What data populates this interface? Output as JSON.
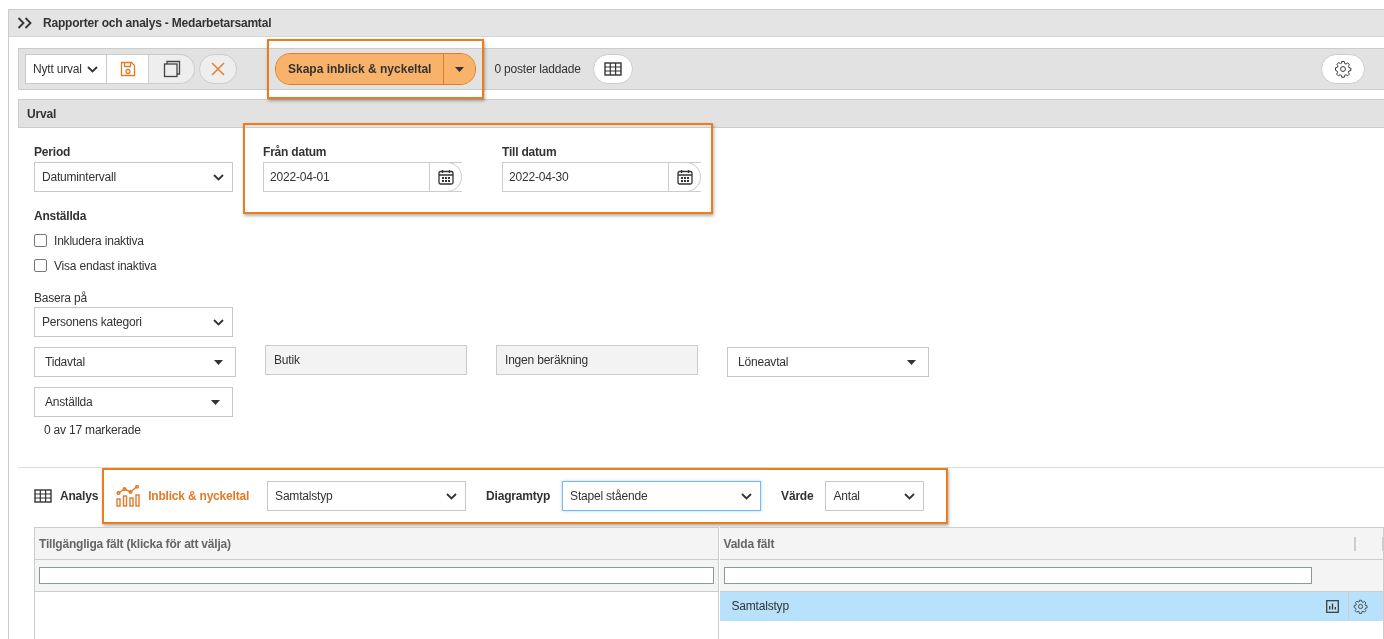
{
  "header": {
    "title": "Rapporter och analys - Medarbetarsamtal"
  },
  "toolbar": {
    "selection": "Nytt urval",
    "primary_action": "Skapa inblick & nyckeltal",
    "highlighted": true,
    "status": "0 poster laddade"
  },
  "urval": {
    "title": "Urval",
    "period": {
      "label": "Period",
      "value": "Datumintervall"
    },
    "dates": {
      "highlighted": true,
      "items": [
        {
          "label": "Från datum",
          "value": "2022-04-01"
        },
        {
          "label": "Till datum",
          "value": "2022-04-30"
        }
      ]
    },
    "employees": {
      "label": "Anställda",
      "options": [
        {
          "label": "Inkludera inaktiva",
          "checked": false
        },
        {
          "label": "Visa endast inaktiva",
          "checked": false
        }
      ]
    },
    "base": {
      "label": "Basera på",
      "value": "Personens kategori"
    },
    "filters": [
      {
        "kind": "dropdown",
        "value": "Tidavtal"
      },
      {
        "kind": "readonly",
        "value": "Butik"
      },
      {
        "kind": "readonly",
        "value": "Ingen beräkning"
      },
      {
        "kind": "dropdown",
        "value": "Löneavtal"
      }
    ],
    "employee_select": {
      "value": "Anställda",
      "count": "0 av 17 markerade"
    }
  },
  "analysis": {
    "tabs": [
      {
        "label": "Analys",
        "selected": false
      },
      {
        "label": "Inblick & nyckeltal",
        "selected": true
      }
    ],
    "highlighted": true,
    "field": "Samtalstyp",
    "chart_type": {
      "label": "Diagramtyp",
      "value": "Stapel stående"
    },
    "value": {
      "label": "Värde",
      "value": "Antal"
    }
  },
  "available_fields": {
    "title": "Tillgängliga fält (klicka för att välja)"
  },
  "selected_fields": {
    "title": "Valda fält",
    "rows": [
      {
        "label": "Samtalstyp",
        "selected": true
      }
    ]
  }
}
